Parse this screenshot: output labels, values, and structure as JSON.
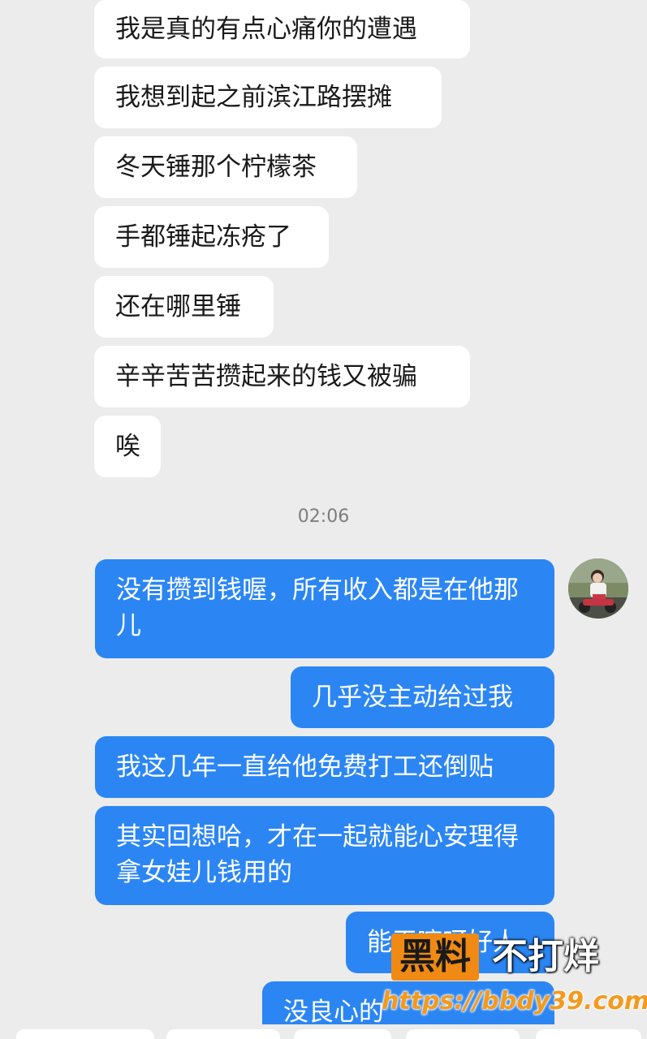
{
  "incoming_messages": [
    "我是真的有点心痛你的遭遇",
    "我想到起之前滨江路摆摊",
    "冬天锤那个柠檬茶",
    "手都锤起冻疮了",
    "还在哪里锤",
    "辛辛苦苦攒起来的钱又被骗",
    "唉"
  ],
  "timestamp": "02:06",
  "outgoing_messages": [
    "没有攒到钱喔，所有收入都是在他那儿",
    "几乎没主动给过我",
    "我这几年一直给他免费打工还倒贴",
    "其实回想哈，才在一起就能心安理得拿女娃儿钱用的",
    "能干嘛呀好人",
    "没良心的"
  ],
  "watermark": {
    "box_text": "黑料",
    "right_text": "不打烊",
    "url": "https://bbdy39.com"
  },
  "colors": {
    "background": "#ececec",
    "incoming_bubble": "#ffffff",
    "outgoing_bubble": "#2b86f3",
    "timestamp_text": "#7d7d7d",
    "watermark_orange": "#f08a14"
  }
}
